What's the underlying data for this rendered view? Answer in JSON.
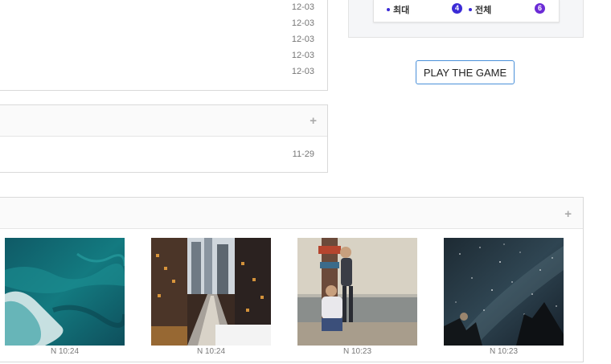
{
  "recent_list": {
    "dates": [
      "12-03",
      "12-03",
      "12-03",
      "12-03",
      "12-03"
    ]
  },
  "second_list": {
    "more_icon": "plus-icon",
    "dates": [
      "11-29"
    ]
  },
  "stats": {
    "max_label": "최대",
    "max_value": "4",
    "total_label": "전체",
    "total_value": "6",
    "max_badge_color": "#3b2bd6",
    "total_badge_color": "#6b2bd6"
  },
  "play_button": {
    "label": "PLAY THE GAME",
    "border_color": "#4a90d9"
  },
  "gallery": {
    "more_icon": "plus-icon",
    "items": [
      {
        "subject": "ocean",
        "caption": "N 10:24"
      },
      {
        "subject": "city-train",
        "caption": "N 10:24"
      },
      {
        "subject": "people-sea",
        "caption": "N 10:23"
      },
      {
        "subject": "night-sky",
        "caption": "N 10:23"
      }
    ]
  }
}
